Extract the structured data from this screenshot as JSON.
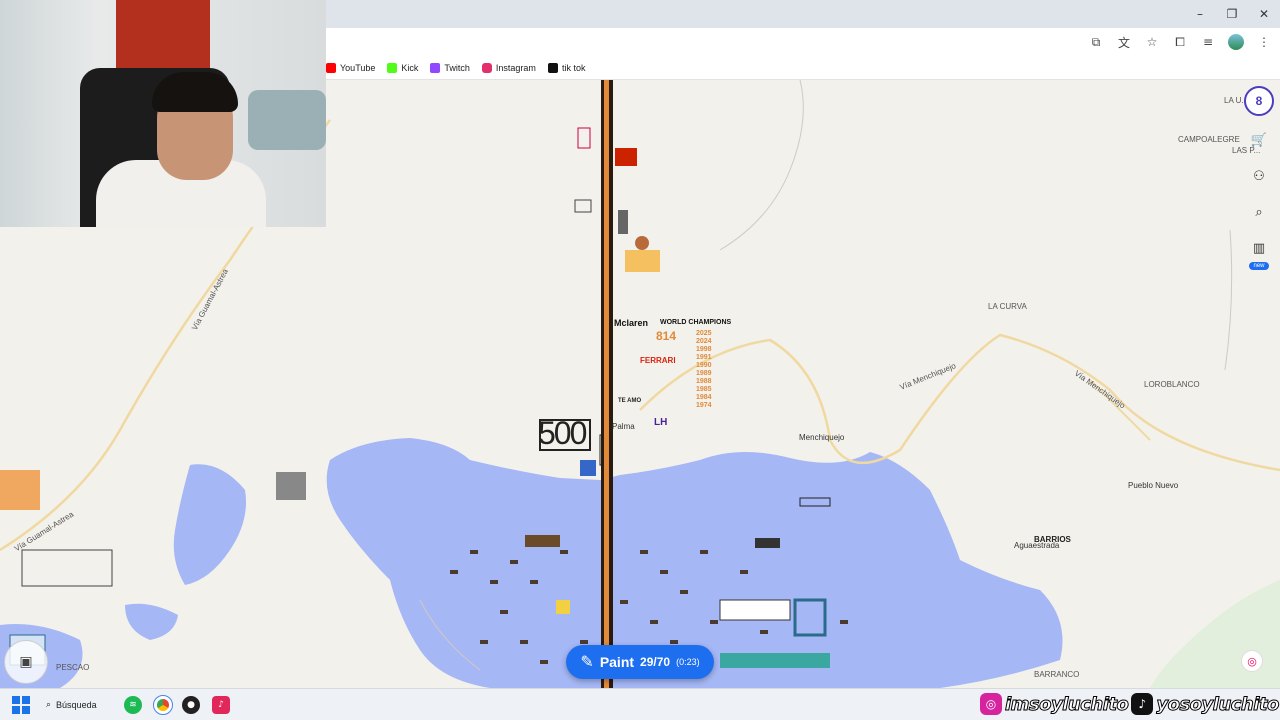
{
  "window": {
    "minimize": "–",
    "maximize": "❐",
    "close": "✕"
  },
  "address_bar": {
    "icons": [
      "cast-icon",
      "translate-icon",
      "star-icon",
      "extensions-icon",
      "media-icon",
      "profile-avatar",
      "menu-icon"
    ]
  },
  "bookmarks": [
    {
      "label": "YouTube",
      "color": "#ff0000",
      "icon": "youtube-icon"
    },
    {
      "label": "Kick",
      "color": "#53fc18",
      "icon": "kick-icon"
    },
    {
      "label": "Twitch",
      "color": "#9146ff",
      "icon": "twitch-icon"
    },
    {
      "label": "Instagram",
      "color": "#e1306c",
      "icon": "instagram-icon"
    },
    {
      "label": "tik tok",
      "color": "#111111",
      "icon": "tiktok-icon"
    }
  ],
  "map": {
    "places": {
      "la_curva": "LA CURVA",
      "campoalegre": "CAMPOALEGRE",
      "las_palmas": "LAS P...",
      "la_u": "LA U...",
      "loroblanco": "LOROBLANCO",
      "menchiquejo": "Menchiquejo",
      "pueblo_nuevo": "Pueblo Nuevo",
      "aguaestrada": "Aguaestrada",
      "barranco": "BARRANCO",
      "palma": "Palma",
      "via_menchiquejo_1": "Vía Menchiquejo",
      "via_menchiquejo_2": "Vía Menchiquejo",
      "via_guamal_1": "Vía Guamal-Astrea",
      "via_guamal_2": "Vía Guamal-Astrea",
      "pescao": "PESCAO",
      "barrios": "BARRIOS"
    },
    "art": {
      "mclaren": "Mclaren",
      "world_champions": "WORLD CHAMPIONS",
      "years": [
        "2025",
        "2024",
        "1998",
        "1991",
        "1990",
        "1989",
        "1988",
        "1985",
        "1984",
        "1974"
      ],
      "ferrari": "FERRARI",
      "number_500": "500",
      "lh": "LH",
      "te_amo": "TE AMO",
      "number_814": "814"
    }
  },
  "paint_button": {
    "label": "Paint",
    "count": "29/70",
    "timer": "(0:23)"
  },
  "side_tools": {
    "logo": "8",
    "new_badge": "new"
  },
  "taskbar": {
    "search_label": "Búsqueda"
  },
  "overlay": {
    "instagram_handle": "imsoyluchito",
    "tiktok_handle": "yosoyluchito"
  },
  "colors": {
    "water": "#a5b7f5",
    "accent": "#1e6ff0",
    "stripe": "#e08a3a"
  }
}
